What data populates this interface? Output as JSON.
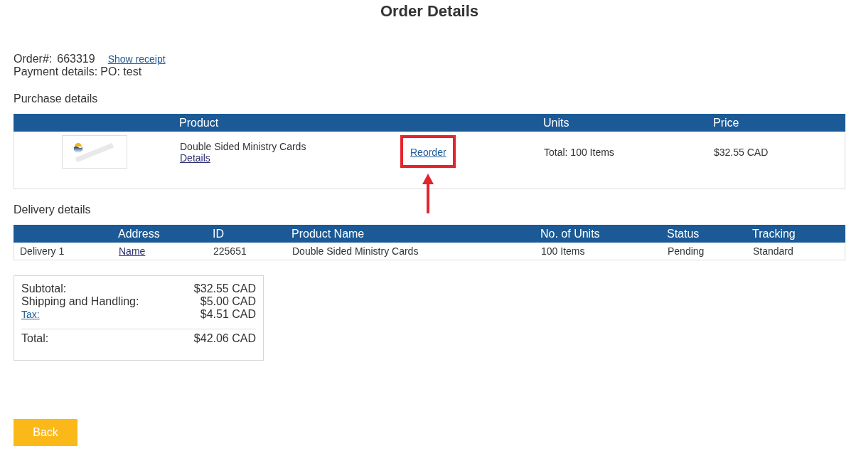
{
  "page": {
    "title": "Order Details"
  },
  "order": {
    "number_label": "Order#:",
    "number": "663319",
    "receipt_link": "Show receipt",
    "payment_label": "Payment details:",
    "payment": "PO: test"
  },
  "purchase": {
    "heading": "Purchase details",
    "columns": [
      {
        "label": "Product"
      },
      {
        "label": "Units"
      },
      {
        "label": "Price"
      }
    ],
    "items": [
      {
        "product_name": "Double Sided Ministry Cards",
        "details_link": "Details",
        "reorder": {
          "label": "Reorder",
          "highlighted": true
        },
        "units": "Total: 100 Items",
        "price": "$32.55 CAD"
      }
    ]
  },
  "delivery": {
    "heading": "Delivery details",
    "columns": [
      "Address",
      "ID",
      "Product Name",
      "No. of Units",
      "Status",
      "Tracking"
    ],
    "rows": [
      {
        "label": "Delivery 1",
        "cells": [
          {
            "kind": "link",
            "text": "Name"
          },
          {
            "kind": "text",
            "text": "225651"
          },
          {
            "kind": "text",
            "text": "Double Sided Ministry Cards"
          },
          {
            "kind": "text",
            "text": "100 Items"
          },
          {
            "kind": "text",
            "text": "Pending"
          },
          {
            "kind": "text",
            "text": "Standard"
          }
        ]
      }
    ]
  },
  "summary": {
    "lines": [
      {
        "kind": "text",
        "label": "Subtotal:",
        "value": "$32.55 CAD"
      },
      {
        "kind": "text",
        "label": "Shipping and Handling:",
        "value": "$5.00 CAD"
      },
      {
        "kind": "link",
        "label": "Tax:",
        "value": "$4.51 CAD"
      }
    ],
    "total": {
      "label": "Total:",
      "value": "$42.06 CAD"
    }
  },
  "back_button": {
    "label": "Back"
  }
}
